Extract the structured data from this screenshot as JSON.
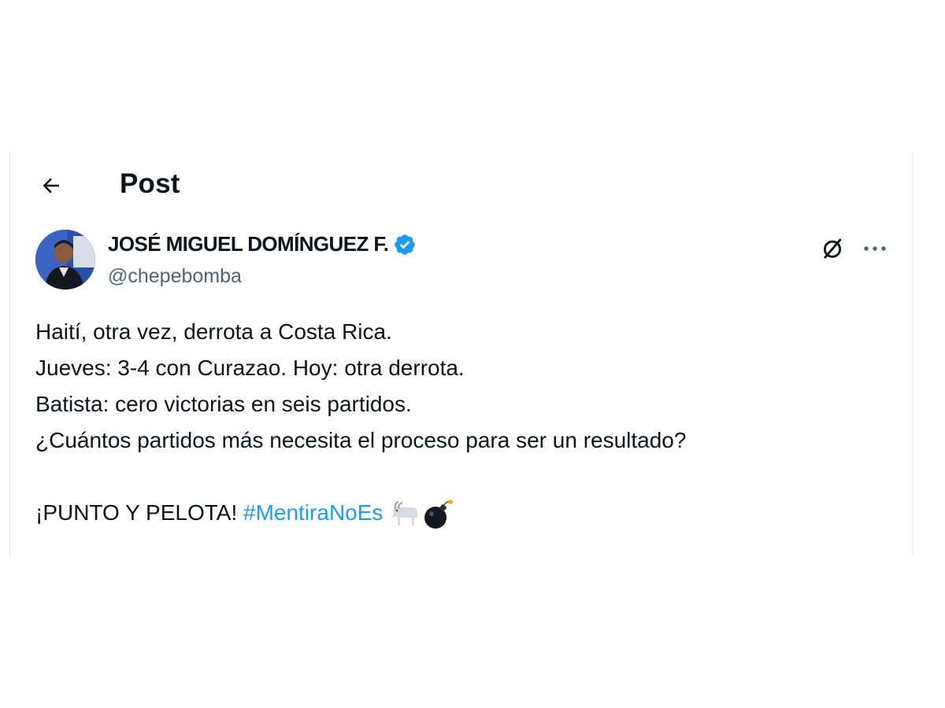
{
  "header": {
    "back_icon": "arrow-left-icon",
    "title": "Post"
  },
  "author": {
    "name": "JOSÉ MIGUEL DOMÍNGUEZ F.",
    "handle": "@chepebomba",
    "verified_icon": "verified-badge-icon",
    "verified_color": "#1d9bf0"
  },
  "actions": {
    "grok_icon": "grok-icon",
    "more_icon": "more-horizontal-icon"
  },
  "post": {
    "lines": [
      "Haití, otra vez, derrota a Costa Rica.",
      "Jueves: 3-4 con Curazao. Hoy: otra derrota.",
      "Batista: cero victorias en seis partidos.",
      "¿Cuántos partidos más necesita el proceso para ser un resultado?"
    ],
    "closing_text": "¡PUNTO Y PELOTA! ",
    "hashtag": "#MentiraNoEs",
    "hashtag_color": "#1d9bf0",
    "emojis": [
      "goat-emoji",
      "bomb-emoji"
    ]
  }
}
